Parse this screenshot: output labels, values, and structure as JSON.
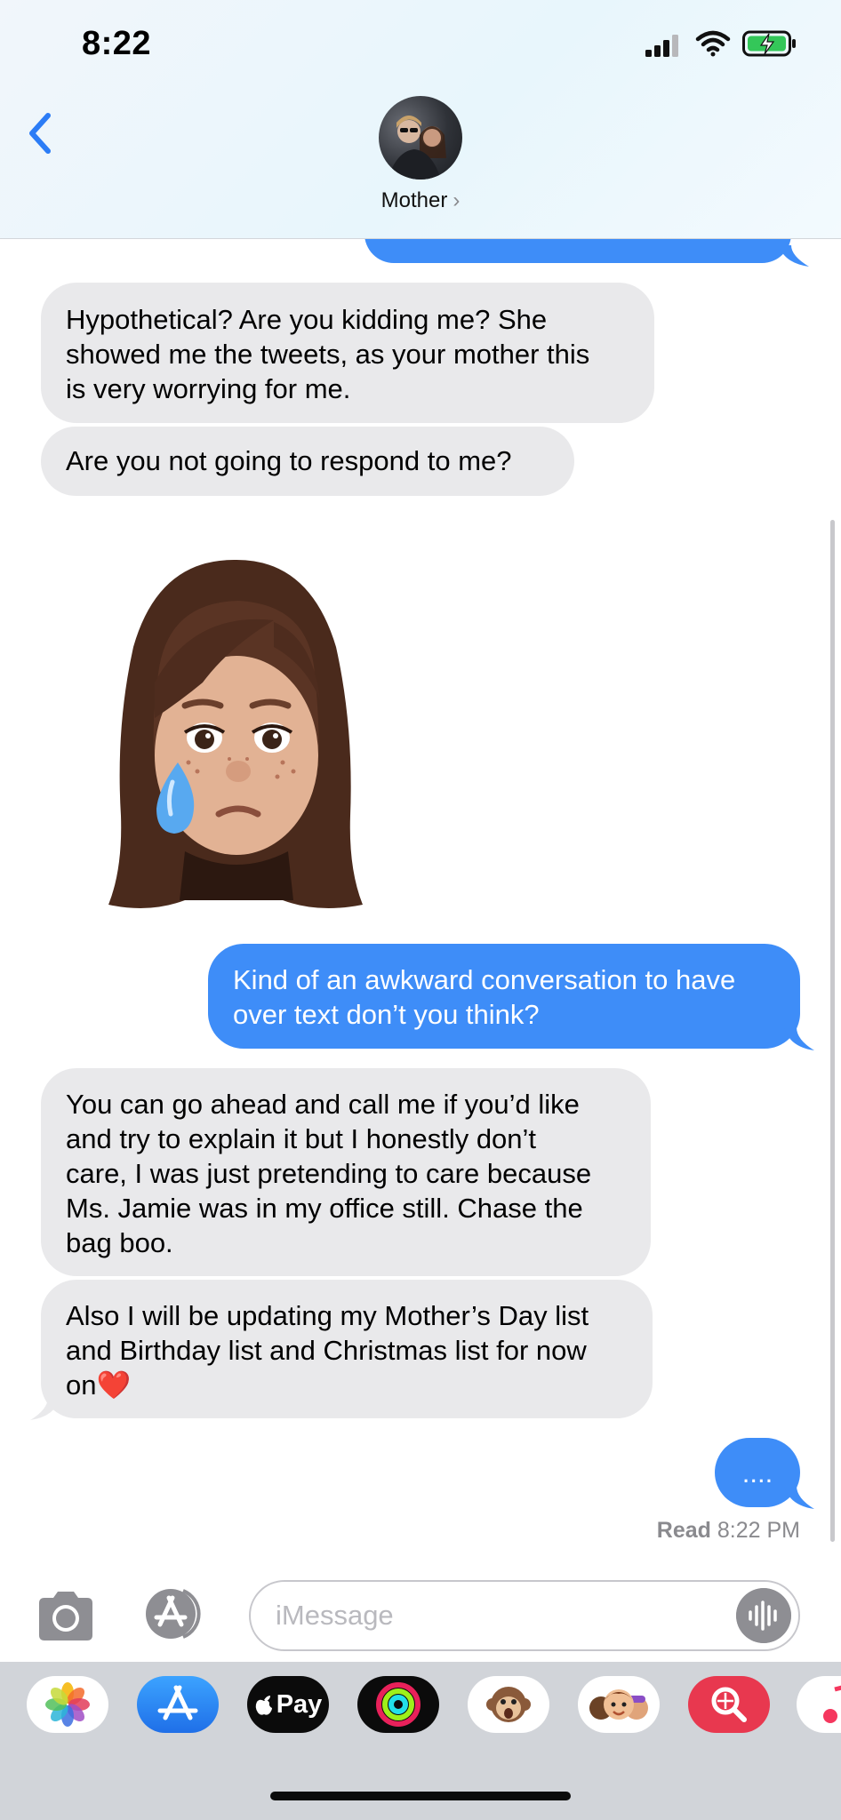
{
  "status_bar": {
    "time": "8:22",
    "signal_icon": "cellular-signal-icon",
    "wifi_icon": "wifi-icon",
    "battery_icon": "battery-charging-icon"
  },
  "header": {
    "back_icon": "chevron-left-icon",
    "contact_name": "Mother",
    "contact_chevron": "›"
  },
  "messages": [
    {
      "from": "them",
      "text": "Hypothetical? Are you kidding me? She\nshowed me the tweets, as your mother this\nis very worrying for me."
    },
    {
      "from": "them",
      "text": "Are you not going to respond to me?"
    },
    {
      "from": "them",
      "type": "memoji",
      "icon": "crying-memoji-sticker"
    },
    {
      "from": "me",
      "text": "Kind of an awkward conversation to have\nover text don’t you think?"
    },
    {
      "from": "them",
      "text": "You can go ahead and call me if you’d like\nand try to explain it but I honestly don’t\ncare, I was just pretending to care because\nMs. Jamie was in my office still. Chase the\nbag boo."
    },
    {
      "from": "them",
      "text": "Also I will be updating my Mother’s Day list\nand Birthday list and Christmas list for now\non",
      "emoji": "❤️"
    },
    {
      "from": "me",
      "text": "...."
    }
  ],
  "receipt": {
    "label": "Read",
    "time": "8:22 PM"
  },
  "composer": {
    "camera_icon": "camera-icon",
    "apps_icon": "app-store-icon",
    "placeholder": "iMessage",
    "audio_icon": "audio-waveform-icon"
  },
  "app_drawer": [
    {
      "name": "photos-app-icon"
    },
    {
      "name": "app-store-app-icon"
    },
    {
      "name": "apple-pay-app-icon",
      "label": "Pay"
    },
    {
      "name": "activity-app-icon"
    },
    {
      "name": "animoji-monkey-app-icon"
    },
    {
      "name": "memoji-app-icon"
    },
    {
      "name": "web-search-app-icon"
    },
    {
      "name": "music-app-icon"
    }
  ],
  "colors": {
    "outgoing_bubble": "#3e8df8",
    "incoming_bubble": "#e9e9eb",
    "accent": "#2b7cf6"
  }
}
